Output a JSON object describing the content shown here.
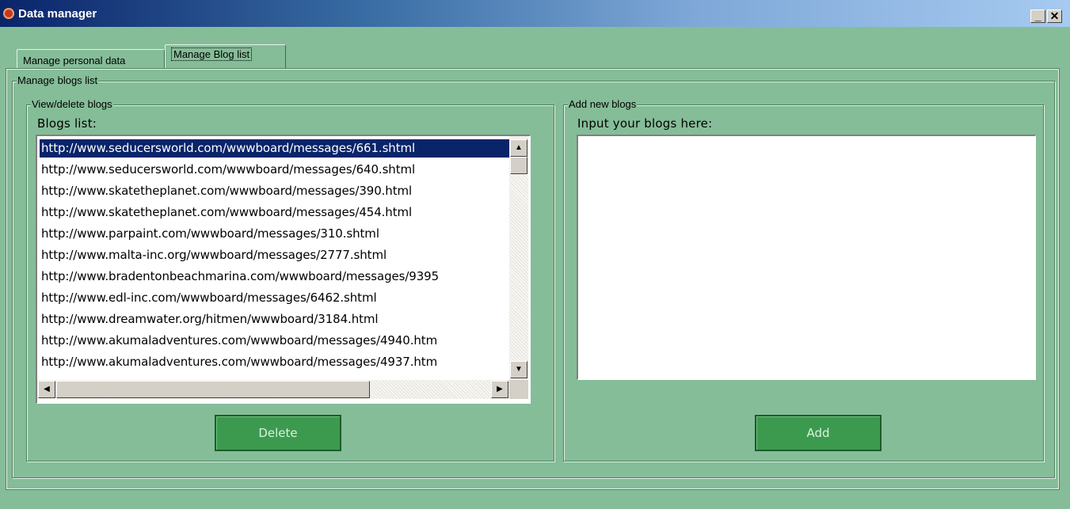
{
  "window": {
    "title": "Data manager",
    "minimize_glyph": "_",
    "close_glyph": "✕"
  },
  "tabs": [
    {
      "label": "Manage personal data"
    },
    {
      "label": "Manage Blog list"
    }
  ],
  "groups": {
    "manage": "Manage blogs list",
    "view": "View/delete blogs",
    "add": "Add new blogs"
  },
  "view": {
    "list_label": "Blogs list:",
    "items": [
      "http://www.seducersworld.com/wwwboard/messages/661.shtml",
      "http://www.seducersworld.com/wwwboard/messages/640.shtml",
      "http://www.skatetheplanet.com/wwwboard/messages/390.html",
      "http://www.skatetheplanet.com/wwwboard/messages/454.html",
      "http://www.parpaint.com/wwwboard/messages/310.shtml",
      "http://www.malta-inc.org/wwwboard/messages/2777.shtml",
      "http://www.bradentonbeachmarina.com/wwwboard/messages/9395",
      "http://www.edl-inc.com/wwwboard/messages/6462.shtml",
      "http://www.dreamwater.org/hitmen/wwwboard/3184.html",
      "http://www.akumaladventures.com/wwwboard/messages/4940.htm",
      "http://www.akumaladventures.com/wwwboard/messages/4937.htm"
    ],
    "selected_index": 0,
    "delete_label": "Delete"
  },
  "add": {
    "input_label": "Input your blogs here:",
    "value": "",
    "add_label": "Add"
  }
}
